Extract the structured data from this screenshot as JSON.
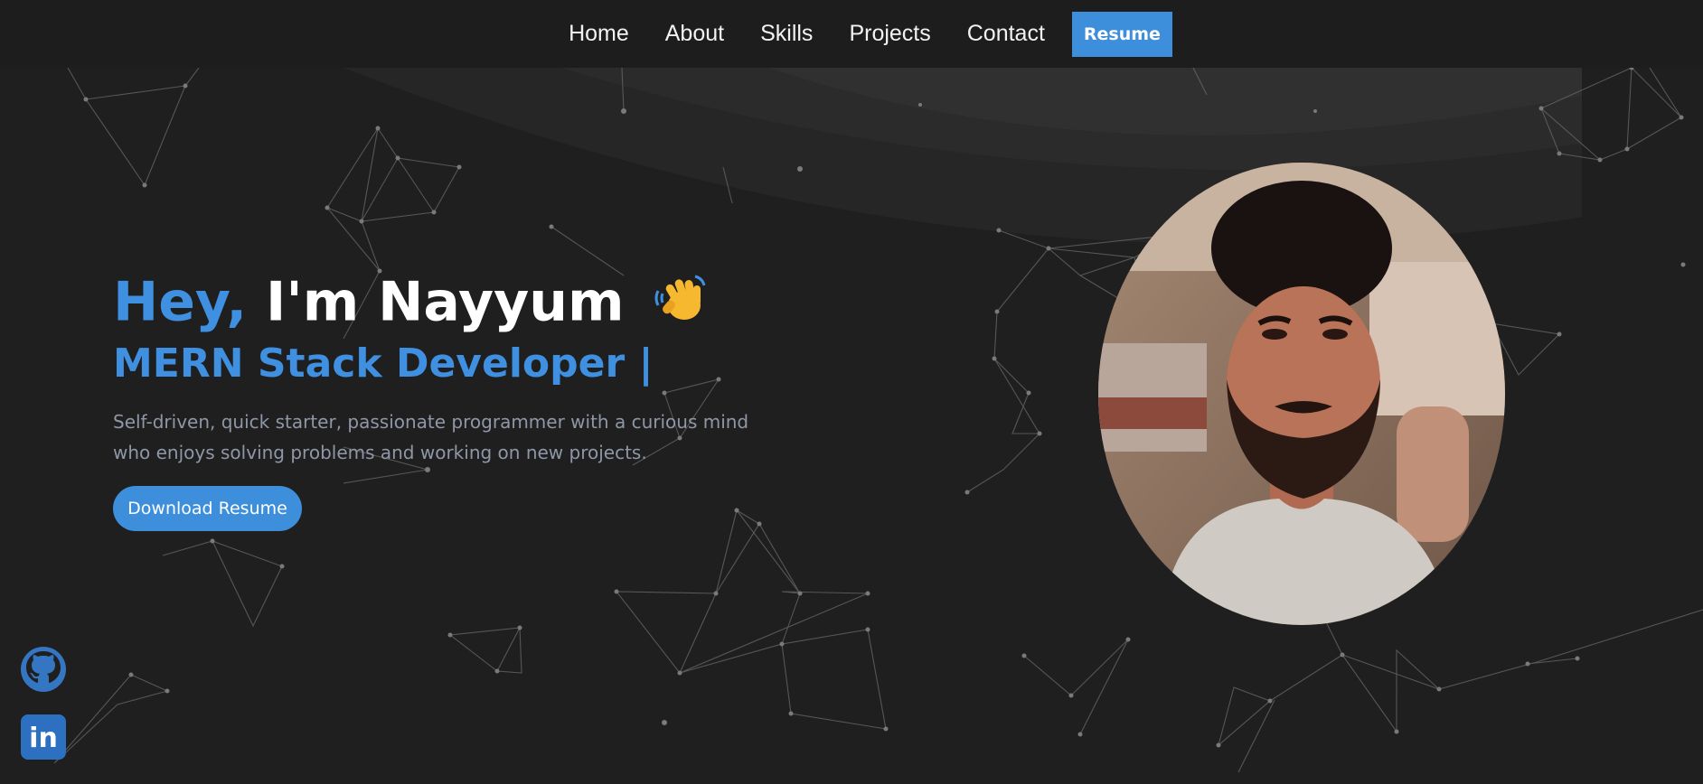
{
  "nav": {
    "links": [
      "Home",
      "About",
      "Skills",
      "Projects",
      "Contact"
    ],
    "resume_label": "Resume"
  },
  "hero": {
    "greeting_accent": "Hey,",
    "greeting_name": "I'm Nayyum",
    "role": "MERN Stack Developer |",
    "bio": "Self-driven, quick starter, passionate programmer with a curious mind who enjoys solving problems and working on new projects.",
    "download_label": "Download Resume"
  },
  "social": {
    "icons": [
      "github-icon",
      "linkedin-icon"
    ],
    "linkedin_text": "in"
  },
  "colors": {
    "accent": "#3d8fdc",
    "background": "#1f1f20",
    "navbar": "#1d1d1d",
    "bio_text": "#8f97a7"
  }
}
